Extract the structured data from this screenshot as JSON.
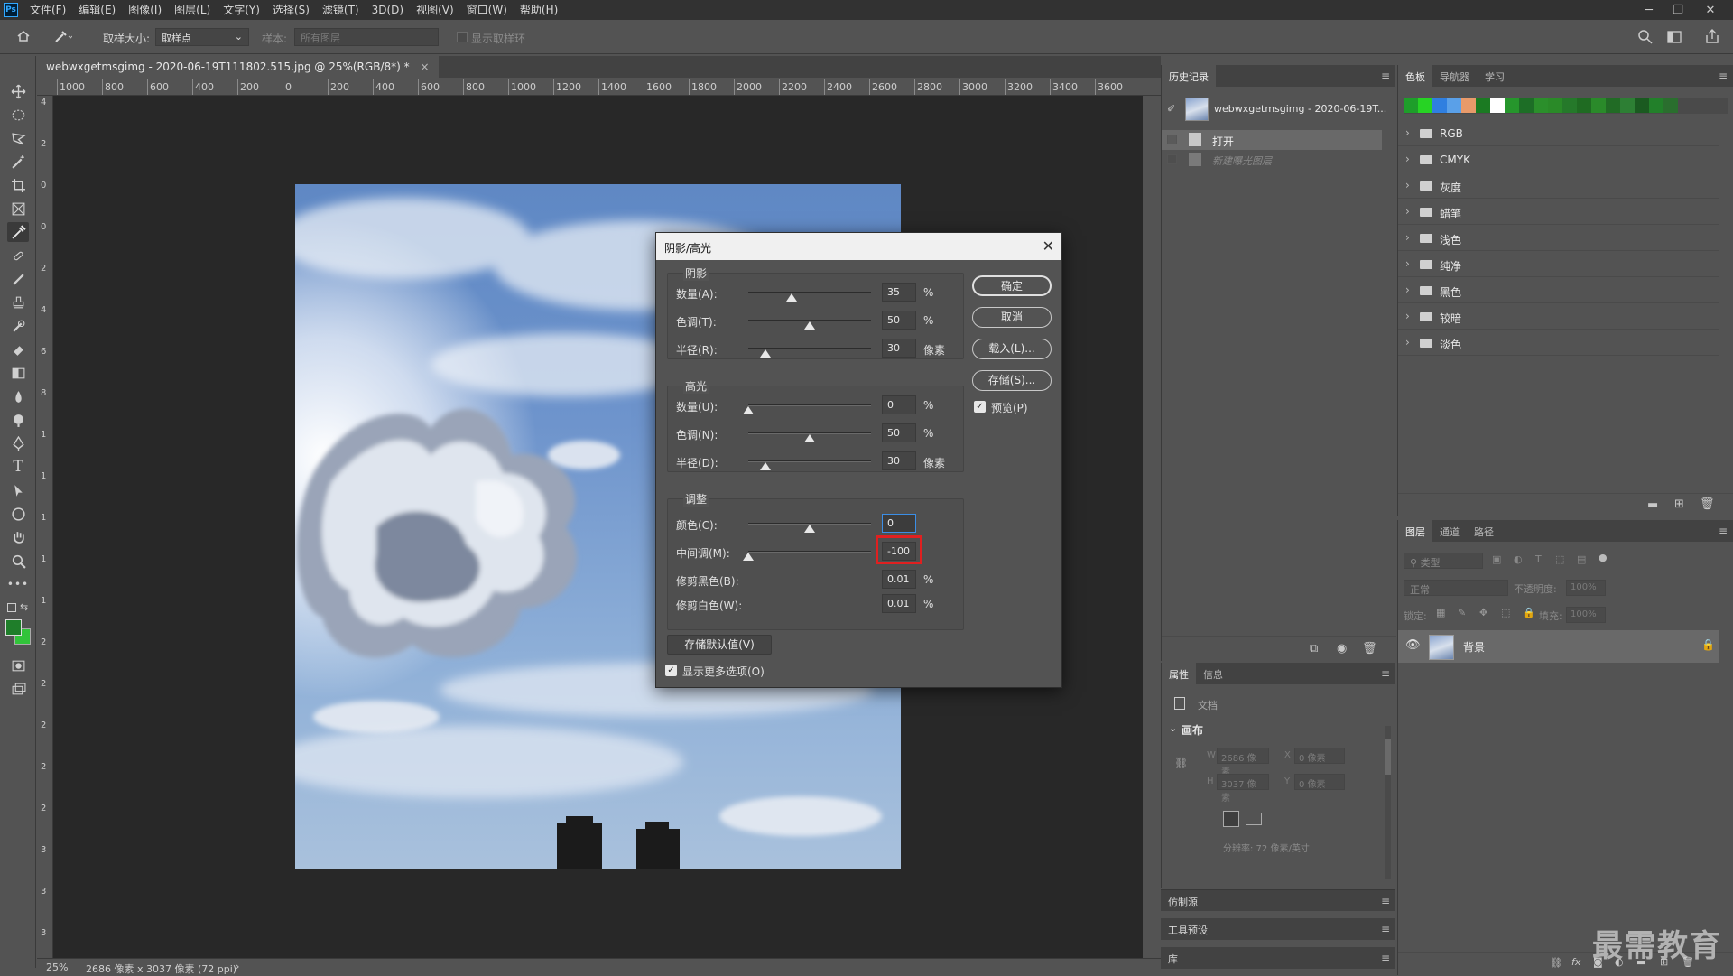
{
  "app": {
    "logo": "Ps"
  },
  "menu": [
    "文件(F)",
    "编辑(E)",
    "图像(I)",
    "图层(L)",
    "文字(Y)",
    "选择(S)",
    "滤镜(T)",
    "3D(D)",
    "视图(V)",
    "窗口(W)",
    "帮助(H)"
  ],
  "options": {
    "sample_size_label": "取样大小:",
    "sample_size_value": "取样点",
    "sample_label": "样本:",
    "sample_value": "所有图层",
    "show_ring_label": "显示取样环"
  },
  "document": {
    "tab_title": "webwxgetmsgimg - 2020-06-19T111802.515.jpg @ 25%(RGB/8*) *",
    "tab_close": "×",
    "zoom": "25%",
    "doc_info": "2686 像素 x 3037 像素 (72 ppi)"
  },
  "ruler": {
    "h_labels": [
      "1000",
      "800",
      "600",
      "400",
      "200",
      "0",
      "200",
      "400",
      "600",
      "800",
      "1000",
      "1200",
      "1400",
      "1600",
      "1800",
      "2000",
      "2200",
      "2400",
      "2600",
      "2800",
      "3000",
      "3200",
      "3400",
      "3600"
    ],
    "v_labels": [
      "4",
      "2",
      "0",
      "0",
      "2",
      "4",
      "6",
      "8",
      "1",
      "1",
      "1",
      "1",
      "1",
      "2",
      "2",
      "2",
      "2",
      "2",
      "3",
      "3",
      "3"
    ]
  },
  "dialog": {
    "title": "阴影/高光",
    "close": "✕",
    "shadows": {
      "title": "阴影",
      "rows": [
        {
          "label": "数量(A):",
          "value": "35",
          "unit": "%",
          "level": 0.35
        },
        {
          "label": "色调(T):",
          "value": "50",
          "unit": "%",
          "level": 0.5
        },
        {
          "label": "半径(R):",
          "value": "30",
          "unit": "像素",
          "level": 0.14
        }
      ]
    },
    "highlights": {
      "title": "高光",
      "rows": [
        {
          "label": "数量(U):",
          "value": "0",
          "unit": "%",
          "level": 0
        },
        {
          "label": "色调(N):",
          "value": "50",
          "unit": "%",
          "level": 0.5
        },
        {
          "label": "半径(D):",
          "value": "30",
          "unit": "像素",
          "level": 0.14
        }
      ]
    },
    "adjust": {
      "title": "调整",
      "color_label": "颜色(C):",
      "color_value": "0",
      "color_level": 0.5,
      "midtone_label": "中间调(M):",
      "midtone_value": "-100",
      "midtone_level": 0,
      "clip_black_label": "修剪黑色(B):",
      "clip_black_value": "0.01",
      "clip_black_unit": "%",
      "clip_white_label": "修剪白色(W):",
      "clip_white_value": "0.01",
      "clip_white_unit": "%"
    },
    "buttons": {
      "ok": "确定",
      "cancel": "取消",
      "load": "载入(L)...",
      "save": "存储(S)..."
    },
    "preview_label": "预览(P)",
    "preview_checked": true,
    "save_default": "存储默认值(V)",
    "more_options_label": "显示更多选项(O)",
    "more_options_checked": true
  },
  "history": {
    "tab": "历史记录",
    "snapshot": "webwxgetmsgimg - 2020-06-19T...",
    "items": [
      {
        "label": "打开",
        "active": true
      },
      {
        "label": "新建曝光图层",
        "active": false
      }
    ]
  },
  "swatches": {
    "tabs": [
      "色板",
      "导航器",
      "学习"
    ],
    "recent_colors": [
      "#1e9e2a",
      "#27d324",
      "#2f7fe0",
      "#5aa0e8",
      "#e89a6a",
      "#1b7a22",
      "#ffffff",
      "#26962c",
      "#1d6e26",
      "#2b8f2b",
      "#2a8a28",
      "#25792a",
      "#1f6b22",
      "#2a8a2a",
      "#216b25",
      "#2d7f34",
      "#1a5a20",
      "#22802a",
      "#2a6e2e"
    ],
    "folders": [
      "RGB",
      "CMYK",
      "灰度",
      "蜡笔",
      "浅色",
      "纯净",
      "黑色",
      "较暗",
      "淡色"
    ]
  },
  "properties": {
    "tabs": [
      "属性",
      "信息"
    ],
    "doc_label": "文档",
    "canvas_label": "画布",
    "w_label": "W",
    "w_value": "2686 像素",
    "h_label": "H",
    "h_value": "3037 像素",
    "x_label": "X",
    "x_value": "0 像素",
    "y_label": "Y",
    "y_value": "0 像素",
    "resolution": "分辨率: 72 像素/英寸"
  },
  "layers": {
    "tabs": [
      "图层",
      "通道",
      "路径"
    ],
    "search_placeholder": "类型",
    "blend_mode": "正常",
    "opacity_label": "不透明度:",
    "opacity_value": "100%",
    "lock_label": "锁定:",
    "fill_label": "填充:",
    "fill_value": "100%",
    "layer_name": "背景"
  },
  "collapsed_panels": [
    "仿制源",
    "工具预设",
    "库"
  ],
  "watermark": "最需教育"
}
